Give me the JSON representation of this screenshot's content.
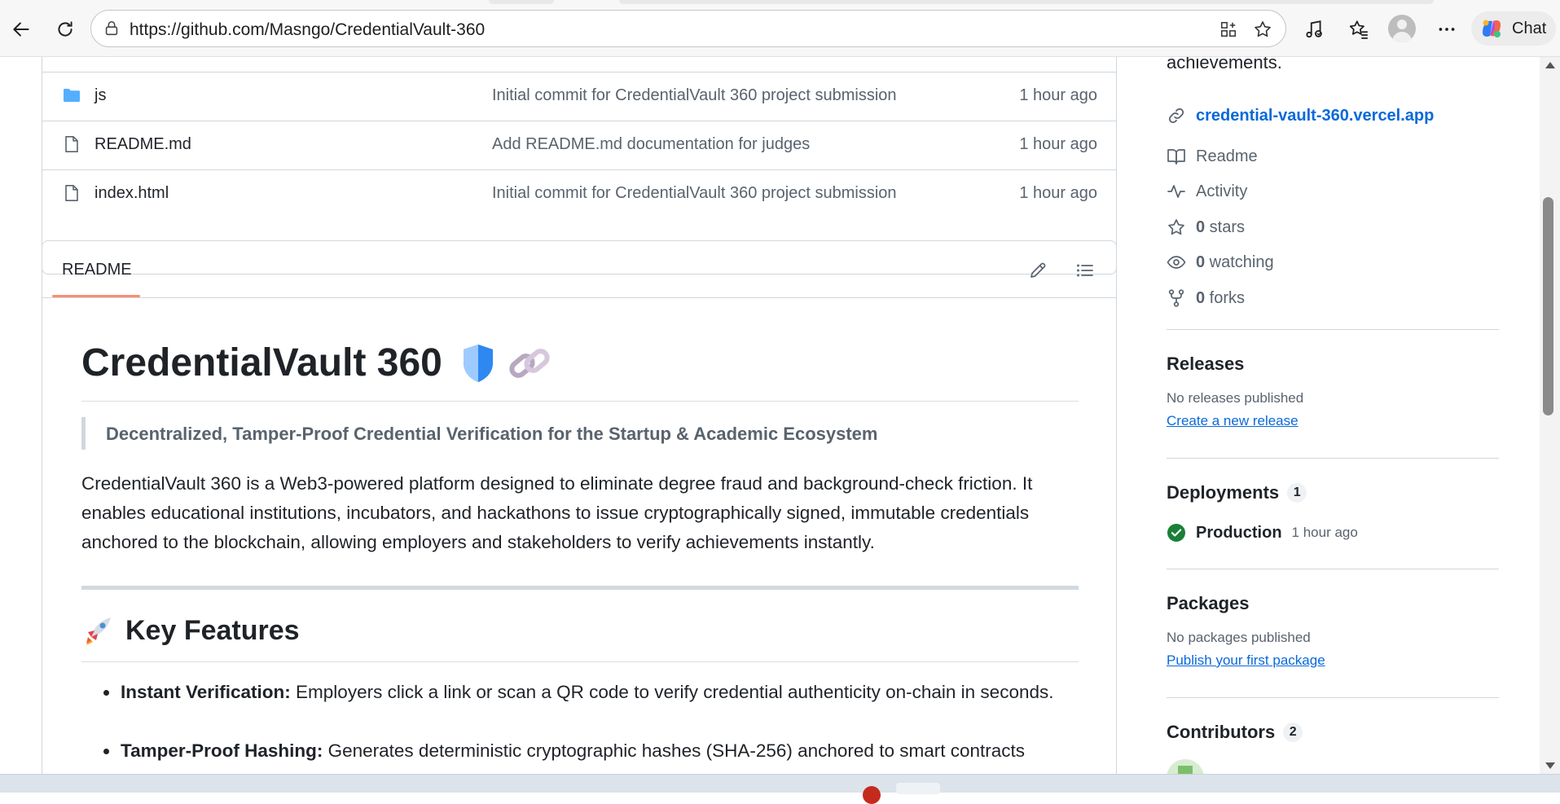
{
  "browser": {
    "url": "https://github.com/Masngo/CredentialVault-360",
    "chat_label": "Chat"
  },
  "files": [
    {
      "name": "js",
      "type": "folder",
      "message": "Initial commit for CredentialVault 360 project submission",
      "time": "1 hour ago"
    },
    {
      "name": "README.md",
      "type": "file",
      "message": "Add README.md documentation for judges",
      "time": "1 hour ago"
    },
    {
      "name": "index.html",
      "type": "file",
      "message": "Initial commit for CredentialVault 360 project submission",
      "time": "1 hour ago"
    }
  ],
  "readme": {
    "tab_label": "README",
    "title": "CredentialVault 360",
    "tagline": "Decentralized, Tamper-Proof Credential Verification for the Startup & Academic Ecosystem",
    "description": "CredentialVault 360 is a Web3-powered platform designed to eliminate degree fraud and background-check friction. It enables educational institutions, incubators, and hackathons to issue cryptographically signed, immutable credentials anchored to the blockchain, allowing employers and stakeholders to verify achievements instantly.",
    "features_heading": "Key Features",
    "features": [
      {
        "label": "Instant Verification:",
        "text": " Employers click a link or scan a QR code to verify credential authenticity on-chain in seconds."
      },
      {
        "label": "Tamper-Proof Hashing:",
        "text": " Generates deterministic cryptographic hashes (SHA-256) anchored to smart contracts"
      }
    ]
  },
  "sidebar": {
    "about_tail": "achievements.",
    "website": "credential-vault-360.vercel.app",
    "readme_label": "Readme",
    "activity_label": "Activity",
    "stars": {
      "count": "0",
      "label": " stars"
    },
    "watching": {
      "count": "0",
      "label": " watching"
    },
    "forks": {
      "count": "0",
      "label": " forks"
    },
    "releases": {
      "heading": "Releases",
      "empty": "No releases published",
      "link": "Create a new release"
    },
    "deployments": {
      "heading": "Deployments",
      "count": "1",
      "name": "Production",
      "time": "1 hour ago"
    },
    "packages": {
      "heading": "Packages",
      "empty": "No packages published",
      "link": "Publish your first package"
    },
    "contributors": {
      "heading": "Contributors",
      "count": "2"
    }
  },
  "colors": {
    "link": "#0969da",
    "muted": "#59636e",
    "tab_accent": "#fd8c73",
    "success": "#1a7f37"
  }
}
